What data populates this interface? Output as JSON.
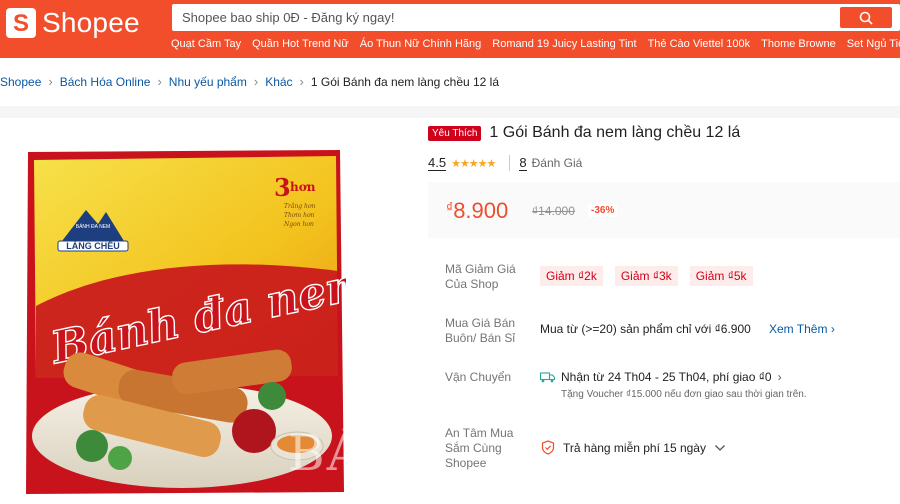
{
  "header": {
    "logo_text": "Shopee",
    "logo_mark": "S",
    "search_placeholder": "Shopee bao ship 0Đ - Đăng ký ngay!",
    "quick_links": [
      "Quạt Cầm Tay",
      "Quần Hot Trend Nữ",
      "Áo Thun Nữ Chính Hãng",
      "Romand 19 Juicy Lasting Tint",
      "Thẻ Cào Viettel 100k",
      "Thome Browne",
      "Set Ngủ Tiểu Thư"
    ]
  },
  "breadcrumb": {
    "items": [
      "Shopee",
      "Bách Hóa Online",
      "Nhu yếu phẩm",
      "Khác"
    ],
    "current": "1 Gói Bánh đa nem làng chều 12 lá"
  },
  "product": {
    "badge": "Yêu Thích",
    "title": "1 Gói Bánh đa nem làng chều 12 lá",
    "rating": "4.5",
    "stars": "★★★★★",
    "review_count": "8",
    "review_label": "Đánh Giá",
    "price_currency": "₫",
    "price": "8.900",
    "old_price": "₫14.000",
    "discount": "-36%",
    "voucher_label": "Mã Giảm Giá Của Shop",
    "vouchers": [
      "Giảm ₫2k",
      "Giảm ₫3k",
      "Giảm ₫5k"
    ],
    "bulk_label": "Mua Giá Bán Buôn/ Bán Sỉ",
    "bulk_text": "Mua từ (>=20) sản phẩm chỉ với ₫6.900",
    "see_more": "Xem Thêm",
    "shipping_label": "Vận Chuyển",
    "shipping_text": "Nhận từ 24 Th04 - 25 Th04, phí giao ₫0",
    "shipping_sub": "Tặng Voucher ₫15.000 nếu đơn giao sau thời gian trên.",
    "assurance_label": "An Tâm Mua Sắm Cùng Shopee",
    "assurance_text": "Trả hàng miễn phí 15 ngày"
  },
  "package": {
    "brand_top": "BÁNH ĐA NEM",
    "brand": "LÀNG CHỀU",
    "claim_num": "3",
    "claim_word": "hơn",
    "claim_lines": [
      "Trắng hơn",
      "Thơm hơn",
      "Ngon hơn"
    ],
    "name": "Bánh đa nem"
  },
  "watermark": "BÁO",
  "colors": {
    "brand": "#f24e2b",
    "price": "#ee4d2d",
    "link": "#0a58a5",
    "star": "#f5a623"
  }
}
